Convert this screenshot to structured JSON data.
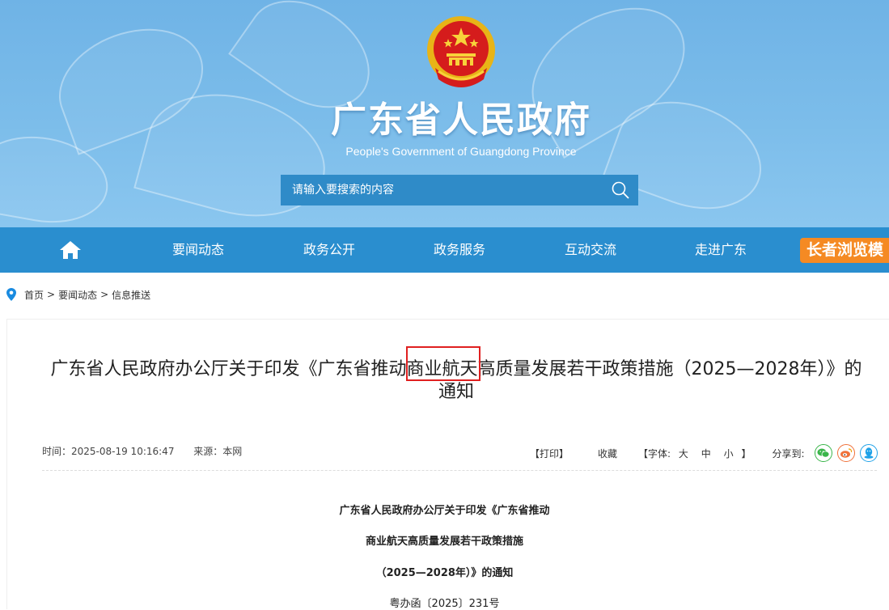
{
  "header": {
    "title": "广东省人民政府",
    "subtitle": "People's Government of Guangdong Province",
    "search_placeholder": "请输入要搜索的内容"
  },
  "nav": {
    "items": [
      "要闻动态",
      "政务公开",
      "政务服务",
      "互动交流",
      "走进广东"
    ],
    "elder_mode": "长者浏览模"
  },
  "breadcrumb": {
    "items": [
      "首页",
      "要闻动态",
      "信息推送"
    ],
    "separator": ">"
  },
  "article": {
    "title_line1": "广东省人民政府办公厅关于印发《广东省推动商业航天高质量发展若干政策措施（2025—2028年）》的",
    "title_line2": "通知",
    "time": "时间：2025-08-19 10:16:47",
    "source": "来源：本网",
    "print": "【打印】",
    "favorite": "收藏",
    "font_label": "【字体:",
    "font_large": "大",
    "font_medium": "中",
    "font_small": "小",
    "font_close": "】",
    "share_label": "分享到:",
    "body_title_1": "广东省人民政府办公厅关于印发《广东省推动",
    "body_title_2": "商业航天高质量发展若干政策措施",
    "body_title_3": "（2025—2028年）》的通知",
    "doc_number": "粤办函〔2025〕231号"
  },
  "colors": {
    "header_blue": "#7cbdea",
    "nav_blue": "#2a8ecf",
    "elder_orange": "#f58a23",
    "highlight_red": "#e02020",
    "wechat_green": "#3ab54a",
    "weibo_orange": "#f0713a",
    "qq_blue": "#1fa2e8"
  },
  "icons": [
    "home-icon",
    "search-icon",
    "location-pin-icon",
    "wechat-icon",
    "weibo-icon",
    "qq-icon",
    "national-emblem"
  ]
}
